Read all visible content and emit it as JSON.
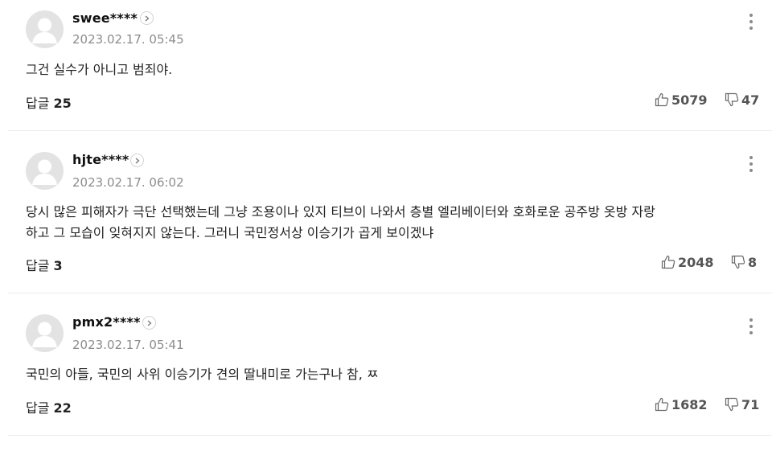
{
  "comments": [
    {
      "username": "swee****",
      "timestamp": "2023.02.17. 05:45",
      "text_lines": [
        "그건 실수가 아니고 범죄야."
      ],
      "reply_label": "답글",
      "reply_count": "25",
      "likes": "5079",
      "dislikes": "47",
      "icons": {
        "profile": "chevron-right-icon",
        "more": "more-vertical-icon",
        "like": "thumbs-up-icon",
        "dislike": "thumbs-down-icon"
      }
    },
    {
      "username": "hjte****",
      "timestamp": "2023.02.17. 06:02",
      "text_lines": [
        "당시 많은 피해자가 극단 선택했는데 그냥 조용이나 있지 티브이 나와서 층별 엘리베이터와 호화로운 공주방 옷방 자랑",
        "하고 그 모습이 잊혀지지 않는다. 그러니 국민정서상 이승기가 곱게 보이겠냐"
      ],
      "reply_label": "답글",
      "reply_count": "3",
      "likes": "2048",
      "dislikes": "8",
      "icons": {
        "profile": "chevron-right-icon",
        "more": "more-vertical-icon",
        "like": "thumbs-up-icon",
        "dislike": "thumbs-down-icon"
      }
    },
    {
      "username": "pmx2****",
      "timestamp": "2023.02.17. 05:41",
      "text_lines": [
        "국민의 아들, 국민의 사위 이승기가 견의 딸내미로 가는구나 참, ㅉ"
      ],
      "reply_label": "답글",
      "reply_count": "22",
      "likes": "1682",
      "dislikes": "71",
      "icons": {
        "profile": "chevron-right-icon",
        "more": "more-vertical-icon",
        "like": "thumbs-up-icon",
        "dislike": "thumbs-down-icon"
      }
    }
  ],
  "colors": {
    "avatar_bg": "#e3e3e3",
    "avatar_fg": "#ffffff",
    "muted_text": "#8c8c8c",
    "divider": "#ececec"
  }
}
